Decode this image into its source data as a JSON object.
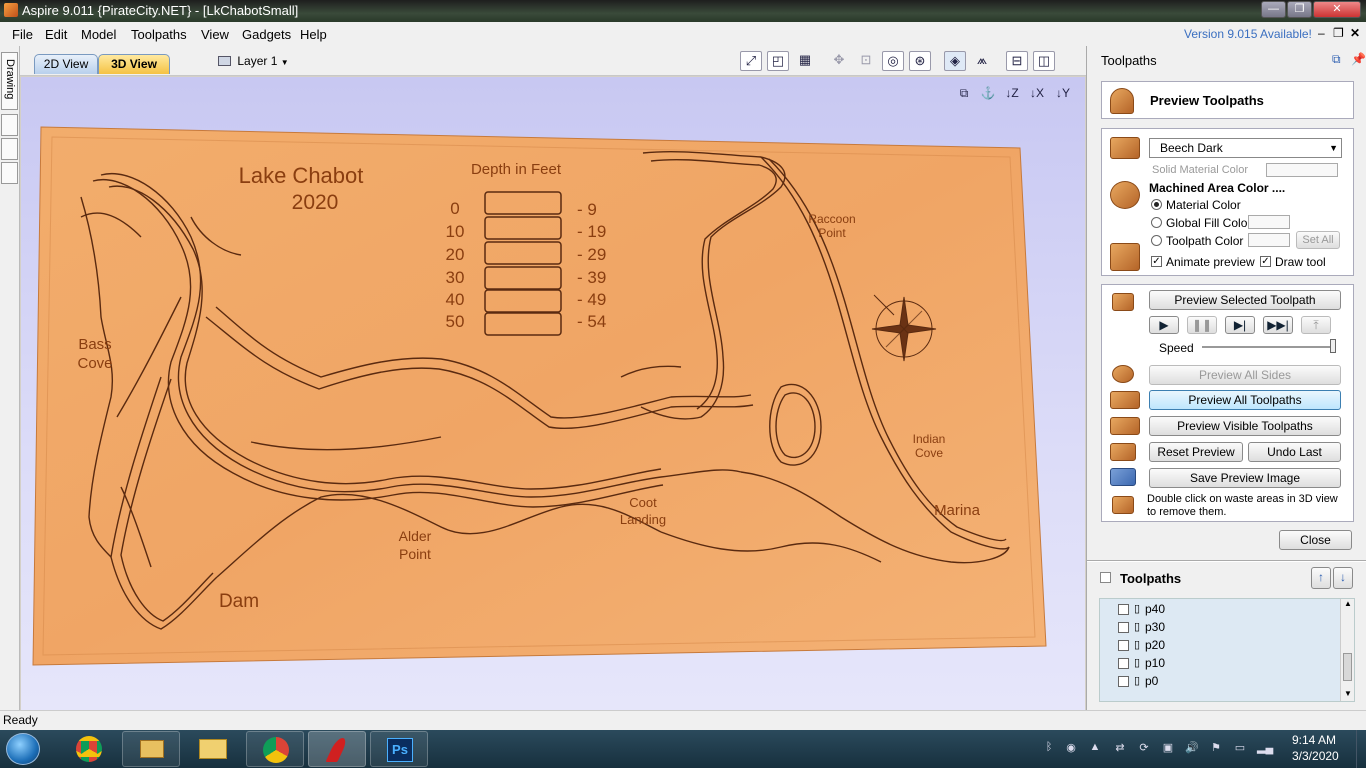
{
  "window": {
    "title": "Aspire 9.011 {PirateCity.NET} - [LkChabotSmall]"
  },
  "menu": {
    "items": [
      "File",
      "Edit",
      "Model",
      "Toolpaths",
      "View",
      "Gadgets",
      "Help"
    ],
    "version_notice": "Version 9.015 Available!"
  },
  "toolbar": {
    "tab_2d": "2D View",
    "tab_3d": "3D View",
    "layer": "Layer 1"
  },
  "left_tabs": {
    "drawing": "Drawing"
  },
  "board": {
    "title_line1": "Lake Chabot",
    "title_line2": "2020",
    "legend_title": "Depth in Feet",
    "legend_rows": [
      {
        "from": "0",
        "to": "- 9"
      },
      {
        "from": "10",
        "to": "- 19"
      },
      {
        "from": "20",
        "to": "- 29"
      },
      {
        "from": "30",
        "to": "- 39"
      },
      {
        "from": "40",
        "to": "- 49"
      },
      {
        "from": "50",
        "to": "- 54"
      }
    ],
    "place_labels": {
      "bass_cove_1": "Bass",
      "bass_cove_2": "Cove",
      "dam": "Dam",
      "alder_1": "Alder",
      "alder_2": "Point",
      "coot_1": "Coot",
      "coot_2": "Landing",
      "raccoon_1": "Raccoon",
      "raccoon_2": "Point",
      "indian_1": "Indian",
      "indian_2": "Cove",
      "marina": "Marina"
    },
    "colors": {
      "wood": "#f0a868",
      "engrave": "#5a2a10"
    }
  },
  "panel": {
    "title": "Toolpaths",
    "heading": "Preview Toolpaths",
    "material": "Beech Dark",
    "solid_material_color": "Solid Material Color",
    "machined_area_color": "Machined Area Color ....",
    "options": {
      "material_color": "Material Color",
      "global_fill_color": "Global Fill Color",
      "toolpath_color": "Toolpath Color"
    },
    "set_all": "Set All",
    "animate_preview": "Animate preview",
    "draw_tool": "Draw tool",
    "preview_selected": "Preview Selected Toolpath",
    "speed": "Speed",
    "speed_level": 1.0,
    "preview_all_sides": "Preview All Sides",
    "preview_all_toolpaths": "Preview All Toolpaths",
    "preview_visible_toolpaths": "Preview Visible Toolpaths",
    "reset_preview": "Reset Preview",
    "undo_last": "Undo Last",
    "save_preview_image": "Save Preview Image",
    "hint_line1": "Double click on waste areas in 3D view",
    "hint_line2": "to remove them.",
    "close": "Close",
    "toolpaths_list_title": "Toolpaths",
    "toolpaths": [
      "p40",
      "p30",
      "p20",
      "p10",
      "p0"
    ]
  },
  "status": {
    "text": "Ready"
  },
  "taskbar": {
    "time": "9:14 AM",
    "date": "3/3/2020"
  }
}
